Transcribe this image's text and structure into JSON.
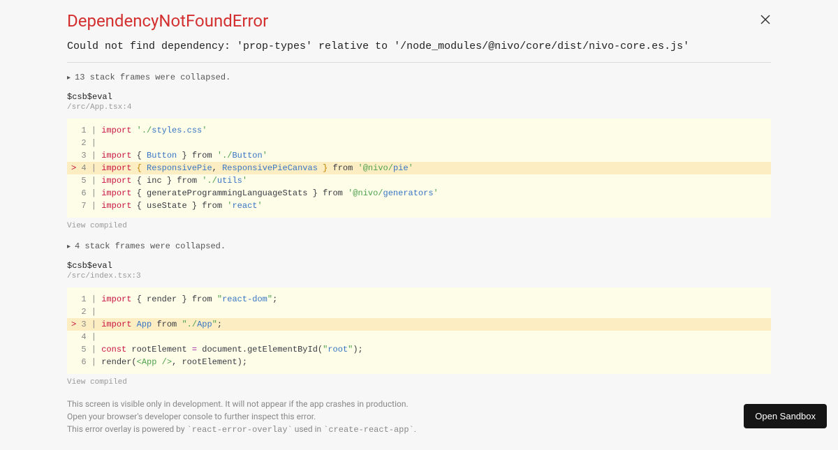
{
  "error": {
    "title": "DependencyNotFoundError",
    "message": "Could not find dependency: 'prop-types' relative to '/node_modules/@nivo/core/dist/nivo-core.es.js'"
  },
  "collapse1": "13 stack frames were collapsed.",
  "frame1": {
    "label": "$csb$eval",
    "path": "/src/App.tsx:4",
    "viewCompiled": "View compiled"
  },
  "collapse2": "4 stack frames were collapsed.",
  "frame2": {
    "label": "$csb$eval",
    "path": "/src/index.tsx:3",
    "viewCompiled": "View compiled"
  },
  "footer": {
    "line1": "This screen is visible only in development. It will not appear if the app crashes in production.",
    "line2": "Open your browser's developer console to further inspect this error.",
    "line3_a": "This error overlay is powered by ",
    "line3_b": "`react-error-overlay`",
    "line3_c": " used in ",
    "line3_d": "`create-react-app`",
    "line3_e": "."
  },
  "openSandbox": "Open Sandbox"
}
